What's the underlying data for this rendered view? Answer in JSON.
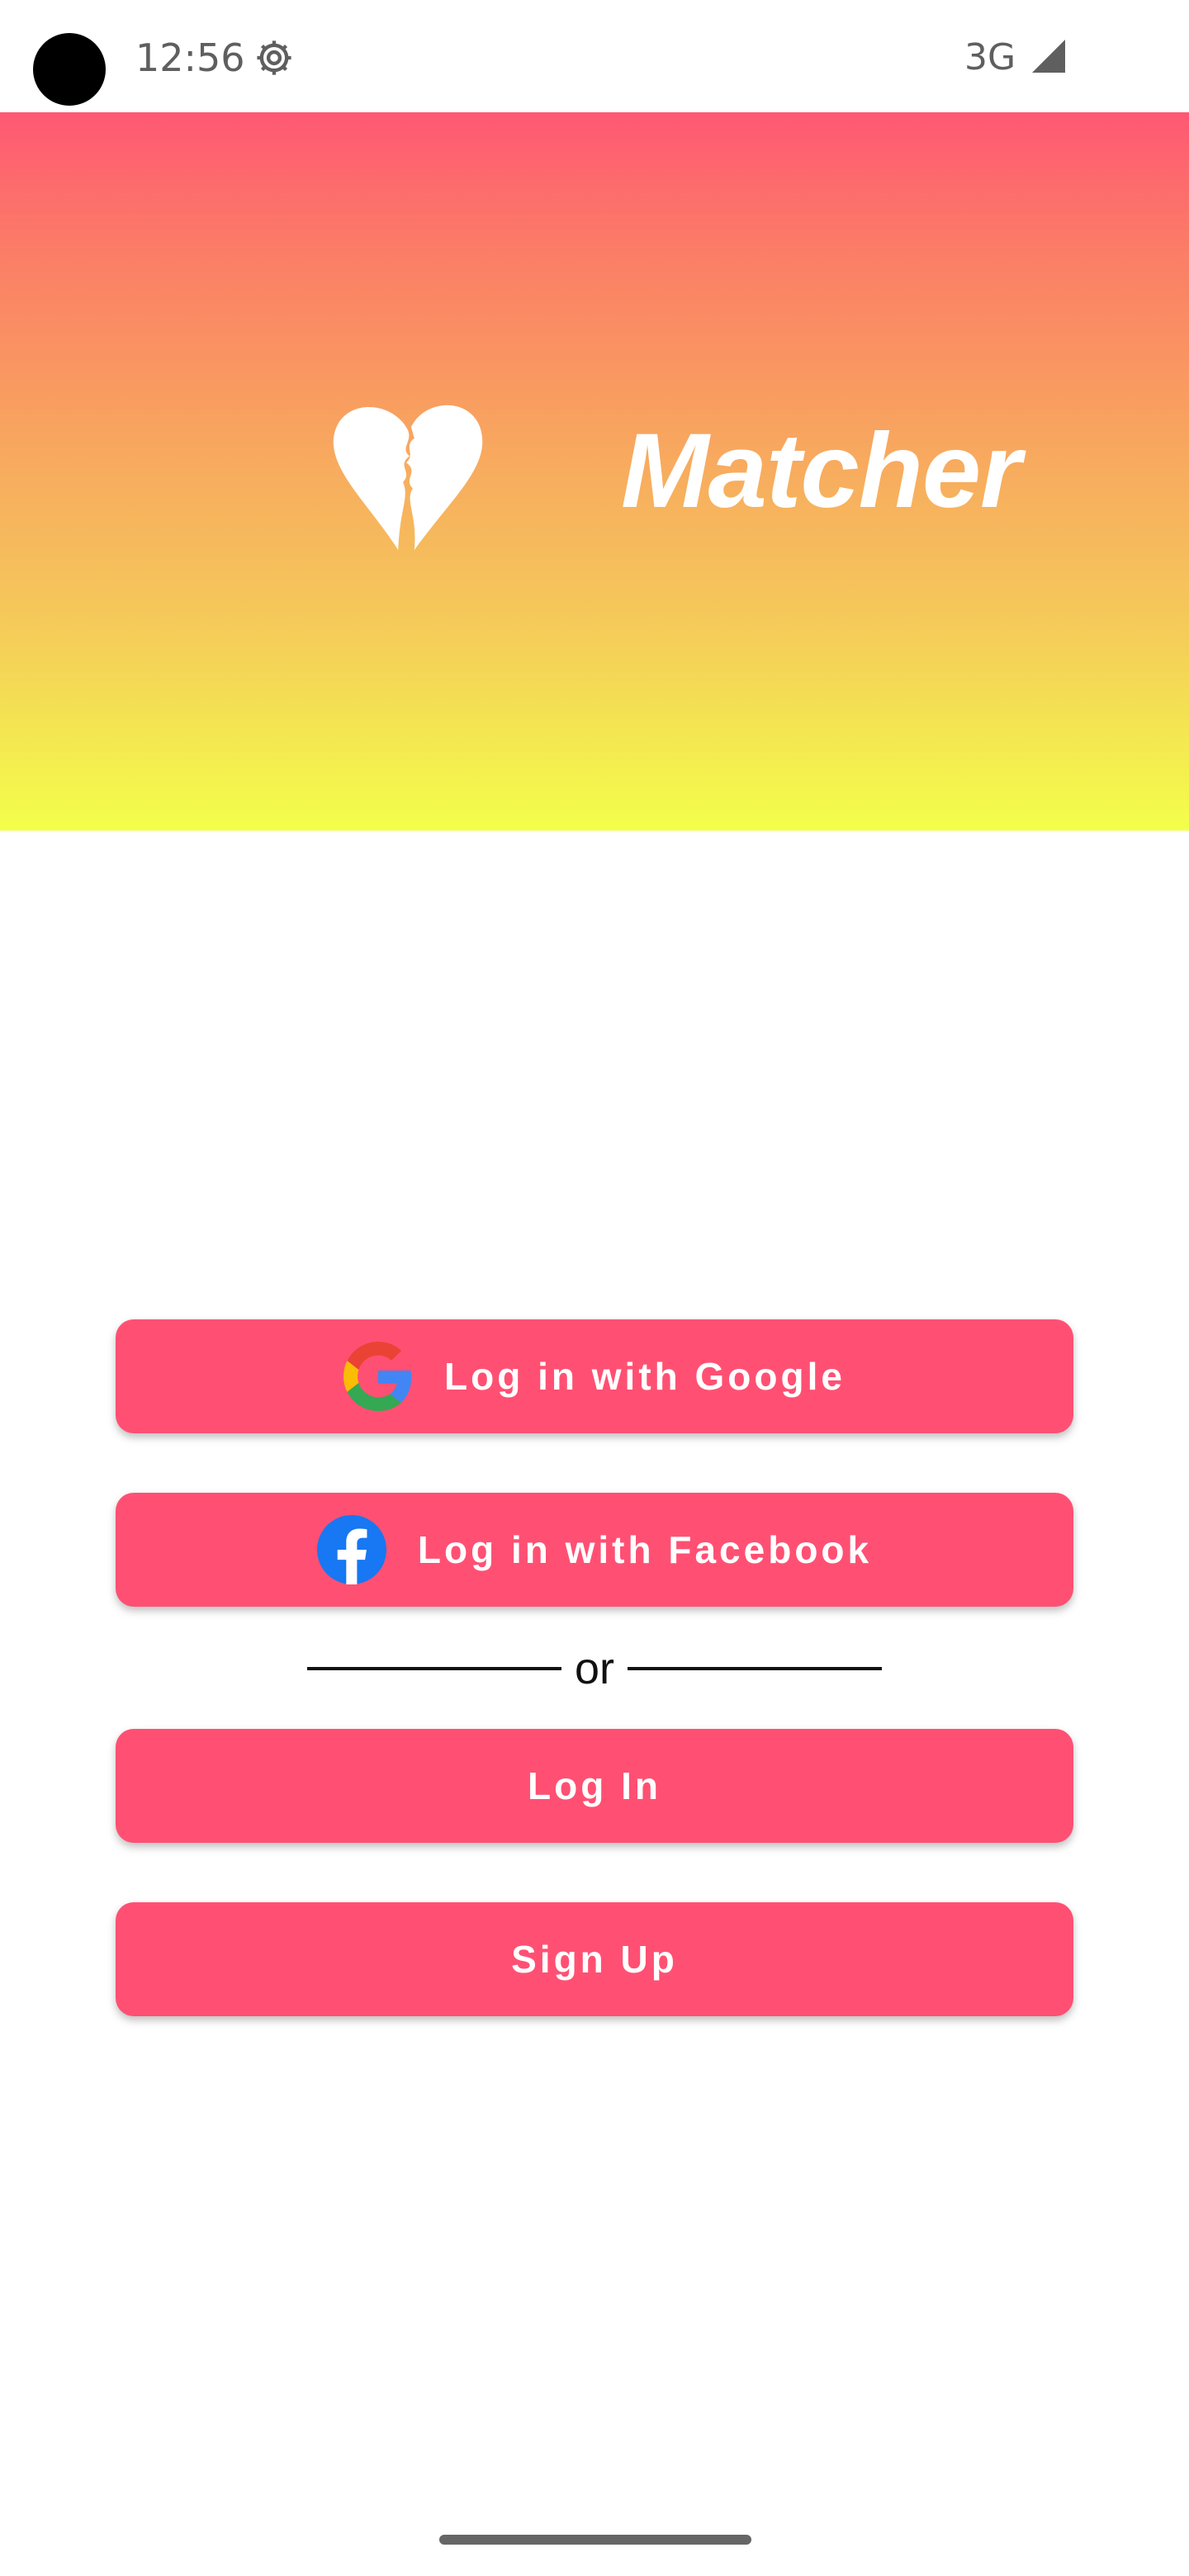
{
  "status_bar": {
    "time": "12:56",
    "network": "3G",
    "icons": [
      "camera-cutout",
      "settings-gear-icon",
      "cell-signal-icon"
    ]
  },
  "header": {
    "app_title": "Matcher",
    "logo_icon": "broken-heart-icon",
    "gradient_colors": [
      "#ff5873",
      "#f8a55f",
      "#f3ff4a"
    ]
  },
  "auth": {
    "google_button": {
      "label": "Log in with Google",
      "icon": "google-g-icon"
    },
    "facebook_button": {
      "label": "Log in with Facebook",
      "icon": "facebook-f-icon"
    },
    "divider_text": "or",
    "login_button": {
      "label": "Log In"
    },
    "signup_button": {
      "label": "Sign Up"
    },
    "button_color": "#ff5073"
  }
}
